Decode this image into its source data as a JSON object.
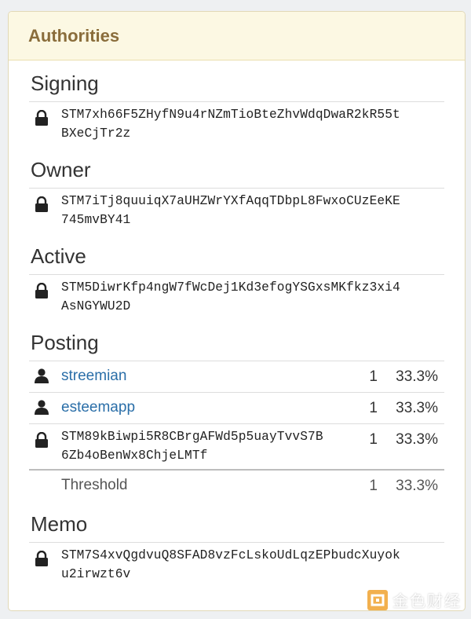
{
  "panel": {
    "title": "Authorities"
  },
  "sections": {
    "signing": {
      "title": "Signing",
      "key_line1": "STM7xh66F5ZHyfN9u4rNZmTioBteZhvWdqDwaR2kR55t",
      "key_line2": "BXeCjTr2z"
    },
    "owner": {
      "title": "Owner",
      "key_line1": "STM7iTj8quuiqX7aUHZWrYXfAqqTDbpL8FwxoCUzEeKE",
      "key_line2": "745mvBY41"
    },
    "active": {
      "title": "Active",
      "key_line1": "STM5DiwrKfp4ngW7fWcDej1Kd3efogYSGxsMKfkz3xi4",
      "key_line2": "AsNGYWU2D"
    },
    "posting": {
      "title": "Posting",
      "accounts": [
        {
          "name": "streemian",
          "weight": "1",
          "percent": "33.3%"
        },
        {
          "name": "esteemapp",
          "weight": "1",
          "percent": "33.3%"
        }
      ],
      "key": {
        "line1": "STM89kBiwpi5R8CBrgAFWd5p5uayTvvS7B",
        "line2": "6Zb4oBenWx8ChjeLMTf",
        "weight": "1",
        "percent": "33.3%"
      },
      "threshold": {
        "label": "Threshold",
        "weight": "1",
        "percent": "33.3%"
      }
    },
    "memo": {
      "title": "Memo",
      "key_line1": "STM7S4xvQgdvuQ8SFAD8vzFcLskoUdLqzEPbudcXuyok",
      "key_line2": "u2irwzt6v"
    }
  },
  "watermark": {
    "text": "金色财经",
    "icon": "jinse-logo-icon"
  },
  "icons": {
    "lock": "lock-icon",
    "user": "user-icon"
  },
  "colors": {
    "header_bg": "#fcf8e3",
    "header_text": "#8a6d3b",
    "link": "#2a6ea8"
  }
}
